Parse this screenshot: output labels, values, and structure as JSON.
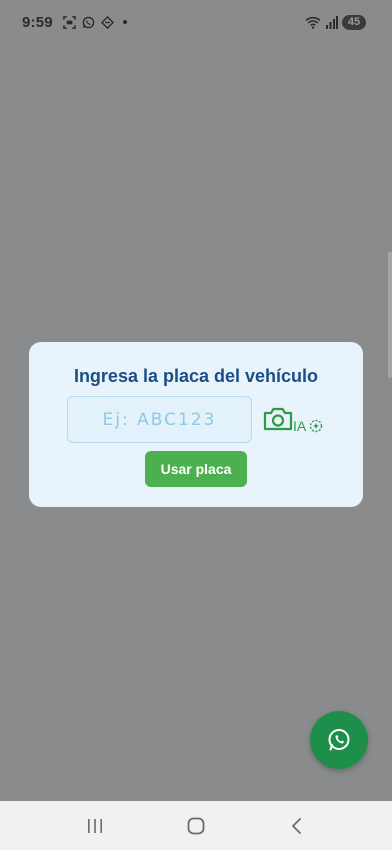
{
  "status_bar": {
    "time": "9:59",
    "battery": "45",
    "icons": [
      "screenshot-icon",
      "whatsapp-icon",
      "vpn-icon",
      "wifi-icon",
      "signal-icon"
    ]
  },
  "dialog": {
    "title": "Ingresa la placa del vehículo",
    "input": {
      "value": "",
      "placeholder": "Ej: ABC123"
    },
    "camera_icon": "camera-icon",
    "ia_label": "IA",
    "ia_icon": "sparkle-icon",
    "use_button_label": "Usar placa"
  },
  "fab": {
    "icon": "whatsapp-icon"
  },
  "nav_bar": {
    "buttons": [
      "recent-apps-icon",
      "home-icon",
      "back-icon"
    ]
  },
  "colors": {
    "overlay": "#8a8b8d",
    "dialog_bg": "#e8f3fb",
    "title": "#1a4f86",
    "accent_green": "#4caf50",
    "whatsapp_green": "#1e8f4a",
    "input_border": "#b4dcf1"
  }
}
